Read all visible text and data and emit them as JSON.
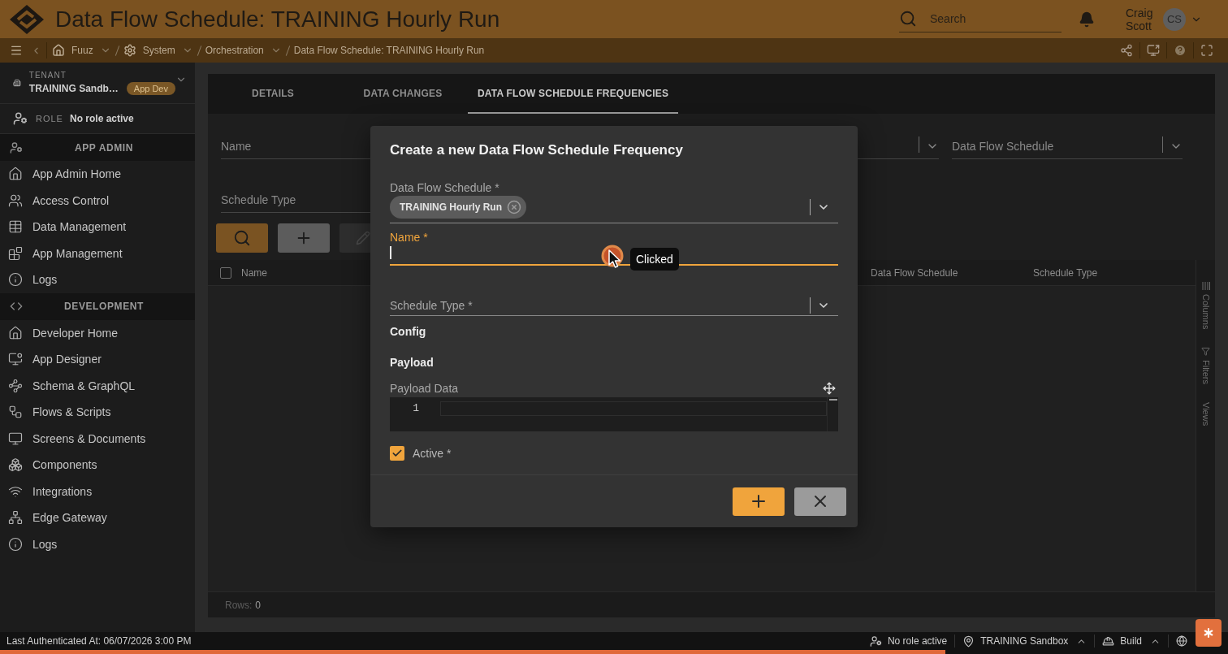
{
  "header": {
    "title": "Data Flow Schedule: TRAINING Hourly Run",
    "search": {
      "placeholder": "Search"
    },
    "user": {
      "name": "Craig Scott",
      "initials": "CS"
    }
  },
  "breadcrumbs": [
    {
      "label": "Fuuz",
      "dropdown": true
    },
    {
      "label": "System",
      "dropdown": true
    },
    {
      "label": "Orchestration",
      "dropdown": true
    },
    {
      "label": "Data Flow Schedule: TRAINING Hourly Run",
      "dropdown": false
    }
  ],
  "sidebar": {
    "tenant": {
      "label": "TENANT",
      "name": "TRAINING Sandb…",
      "badge": "App Dev"
    },
    "role": {
      "label": "ROLE",
      "value": "No role active"
    },
    "sections": [
      {
        "title": "APP ADMIN",
        "items": [
          {
            "label": "App Admin Home"
          },
          {
            "label": "Access Control"
          },
          {
            "label": "Data Management"
          },
          {
            "label": "App Management"
          },
          {
            "label": "Logs"
          }
        ]
      },
      {
        "title": "DEVELOPMENT",
        "items": [
          {
            "label": "Developer Home"
          },
          {
            "label": "App Designer"
          },
          {
            "label": "Schema & GraphQL"
          },
          {
            "label": "Flows & Scripts"
          },
          {
            "label": "Screens & Documents"
          },
          {
            "label": "Components"
          },
          {
            "label": "Integrations"
          },
          {
            "label": "Edge Gateway"
          },
          {
            "label": "Logs"
          }
        ]
      }
    ]
  },
  "main": {
    "tabs": [
      {
        "label": "DETAILS",
        "selected": false
      },
      {
        "label": "DATA CHANGES",
        "selected": false
      },
      {
        "label": "DATA FLOW SCHEDULE FREQUENCIES",
        "selected": true
      }
    ],
    "filters": [
      [
        {
          "kind": "text",
          "placeholder": "Name"
        },
        {
          "kind": "select"
        },
        {
          "kind": "select",
          "placeholder": "Data Flow Schedule"
        }
      ],
      [
        {
          "kind": "text",
          "placeholder": "Schedule Type"
        }
      ]
    ],
    "toolbar": [
      {
        "kind": "search",
        "disabled": false
      },
      {
        "kind": "add",
        "disabled": false
      },
      {
        "kind": "edit",
        "disabled": true
      }
    ],
    "table": {
      "select_all": {
        "checked": false
      },
      "columns": [
        {
          "label": "Name"
        },
        {
          "label": "Data Flow Schedule"
        },
        {
          "label": "Schedule Type"
        }
      ],
      "footer": {
        "label": "Rows:",
        "count": "0"
      }
    },
    "side_tabs": [
      {
        "label": "Columns"
      },
      {
        "label": "Filters"
      },
      {
        "label": "Views"
      }
    ]
  },
  "dialog": {
    "title": "Create a new Data Flow Schedule Frequency",
    "fields": [
      {
        "kind": "multiselect",
        "label": "Data Flow Schedule *",
        "chips": [
          "TRAINING Hourly Run"
        ]
      },
      {
        "kind": "text",
        "label": "Name *",
        "focused": true
      },
      {
        "kind": "select",
        "label": "Schedule Type *"
      },
      {
        "kind": "heading",
        "label": "Config"
      },
      {
        "kind": "heading",
        "label": "Payload"
      },
      {
        "kind": "code",
        "label": "Payload Data",
        "line_numbers": [
          "1"
        ]
      },
      {
        "kind": "checkbox",
        "label": "Active *",
        "checked": true
      }
    ],
    "buttons": [
      {
        "kind": "add"
      },
      {
        "kind": "cancel"
      }
    ]
  },
  "click_indicator": {
    "label": "Clicked"
  },
  "status_bar": {
    "last_authenticated": "Last Authenticated At: 06/07/2026 3:00 PM",
    "items": [
      {
        "label": "No role active",
        "menu": false
      },
      {
        "label": "TRAINING Sandbox",
        "menu": true
      },
      {
        "label": "Build",
        "menu": true
      }
    ],
    "progress": {
      "level": 0.77
    }
  }
}
